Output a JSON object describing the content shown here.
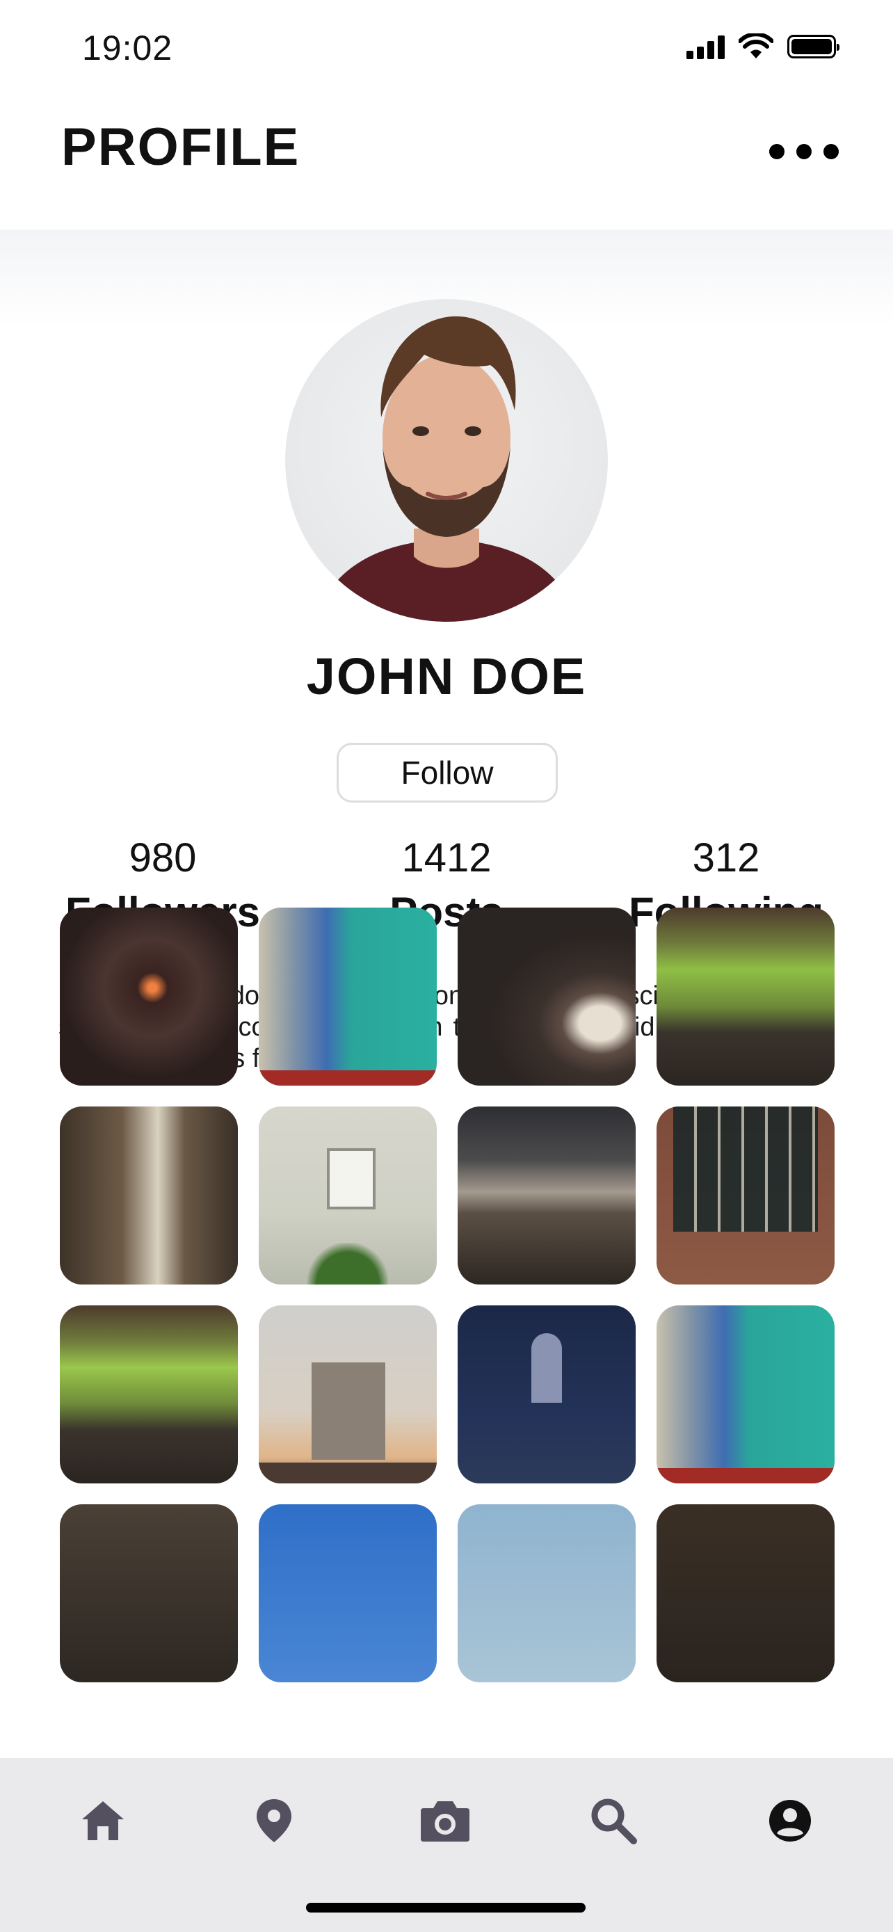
{
  "status_bar": {
    "time": "19:02"
  },
  "header": {
    "title": "PROFILE"
  },
  "profile": {
    "name": "JOHN DOE",
    "follow_label": "Follow",
    "stats": [
      {
        "value": "980",
        "label": "Followers"
      },
      {
        "value": "1412",
        "label": "Posts"
      },
      {
        "value": "312",
        "label": "Following"
      }
    ],
    "bio": "Lorem ipsum dolor sit amet, consectetur adipiscing elit. Massa sed mi cursus commodo sapien tincidunt tellus id Non fusce mi, nec integer quis fams."
  },
  "gallery_icons": [
    "photo"
  ],
  "tab_bar": {
    "items": [
      {
        "icon": "home-icon"
      },
      {
        "icon": "location-pin-icon"
      },
      {
        "icon": "camera-icon"
      },
      {
        "icon": "search-icon"
      },
      {
        "icon": "account-icon"
      }
    ],
    "active_color": "#111111",
    "inactive_color": "#55505f"
  }
}
